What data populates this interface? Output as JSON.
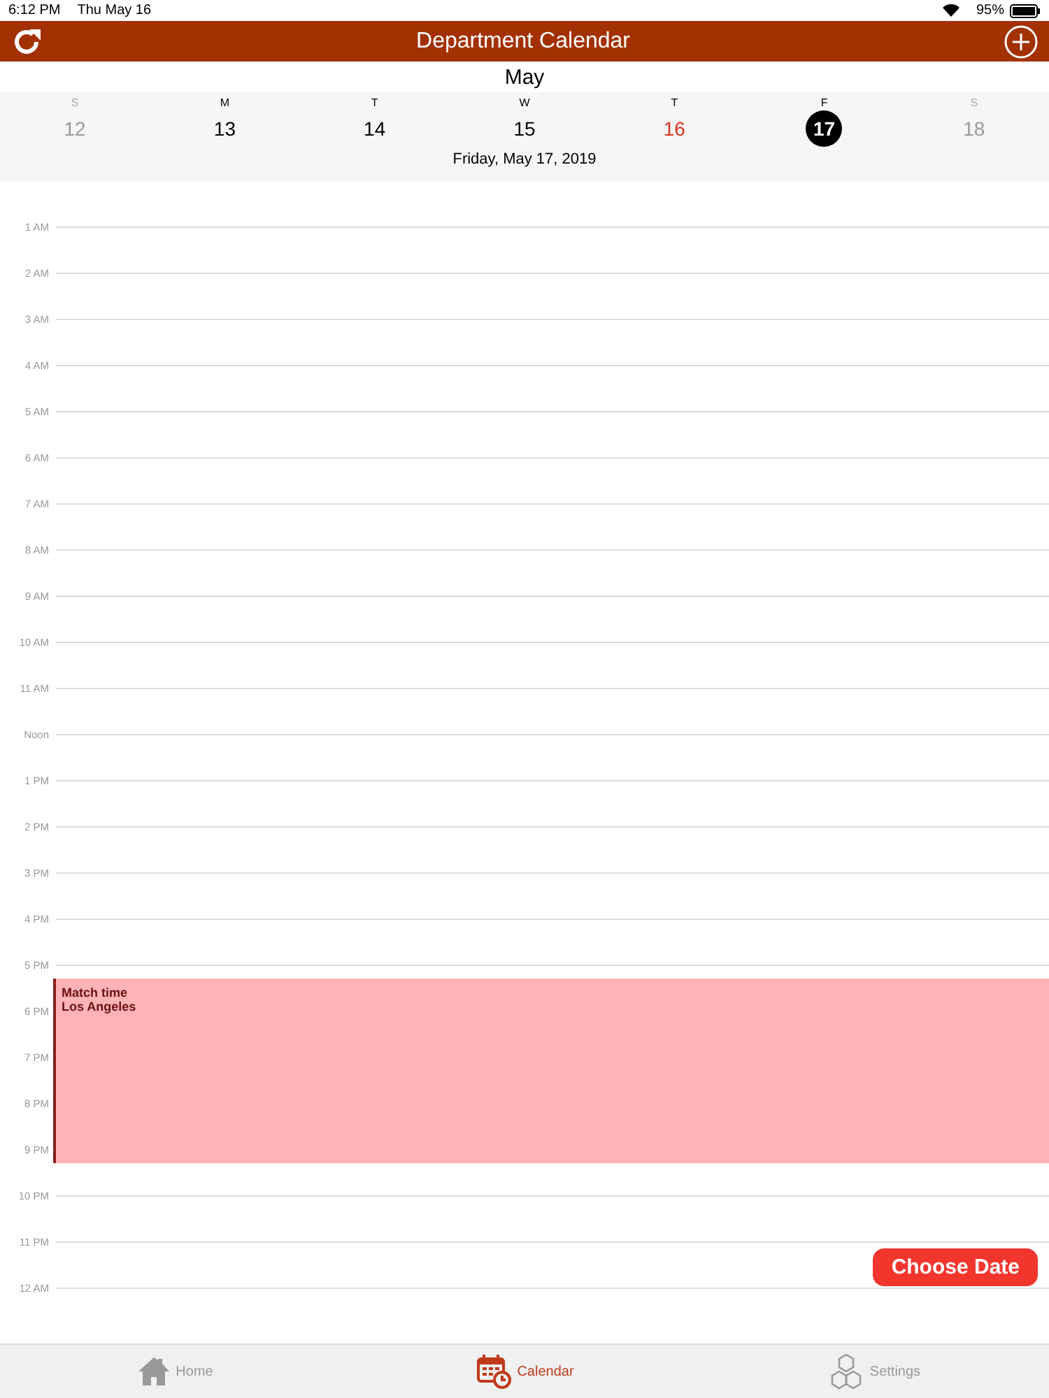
{
  "status_bar": {
    "time": "6:12 PM",
    "date": "Thu May 16",
    "battery": "95%"
  },
  "header": {
    "title": "Department Calendar"
  },
  "month": "May",
  "days": [
    {
      "letter": "S",
      "number": "12",
      "weekend": true,
      "today": false,
      "selected": false
    },
    {
      "letter": "M",
      "number": "13",
      "weekend": false,
      "today": false,
      "selected": false
    },
    {
      "letter": "T",
      "number": "14",
      "weekend": false,
      "today": false,
      "selected": false
    },
    {
      "letter": "W",
      "number": "15",
      "weekend": false,
      "today": false,
      "selected": false
    },
    {
      "letter": "T",
      "number": "16",
      "weekend": false,
      "today": true,
      "selected": false
    },
    {
      "letter": "F",
      "number": "17",
      "weekend": false,
      "today": false,
      "selected": true
    },
    {
      "letter": "S",
      "number": "18",
      "weekend": true,
      "today": false,
      "selected": false
    }
  ],
  "selected_date": "Friday, May 17, 2019",
  "hours": [
    "1 AM",
    "2 AM",
    "3 AM",
    "4 AM",
    "5 AM",
    "6 AM",
    "7 AM",
    "8 AM",
    "9 AM",
    "10 AM",
    "11 AM",
    "Noon",
    "1 PM",
    "2 PM",
    "3 PM",
    "4 PM",
    "5 PM",
    "6 PM",
    "7 PM",
    "8 PM",
    "9 PM",
    "10 PM",
    "11 PM",
    "12 AM"
  ],
  "events": [
    {
      "title": "Match time",
      "location": "Los Angeles",
      "color": "#ffb3b6"
    }
  ],
  "choose_date_button": "Choose Date",
  "tabs": [
    {
      "label": "Home",
      "kind": "home",
      "selected": false
    },
    {
      "label": "Calendar",
      "kind": "calendar",
      "selected": true
    },
    {
      "label": "Settings",
      "kind": "settings",
      "selected": false
    }
  ]
}
